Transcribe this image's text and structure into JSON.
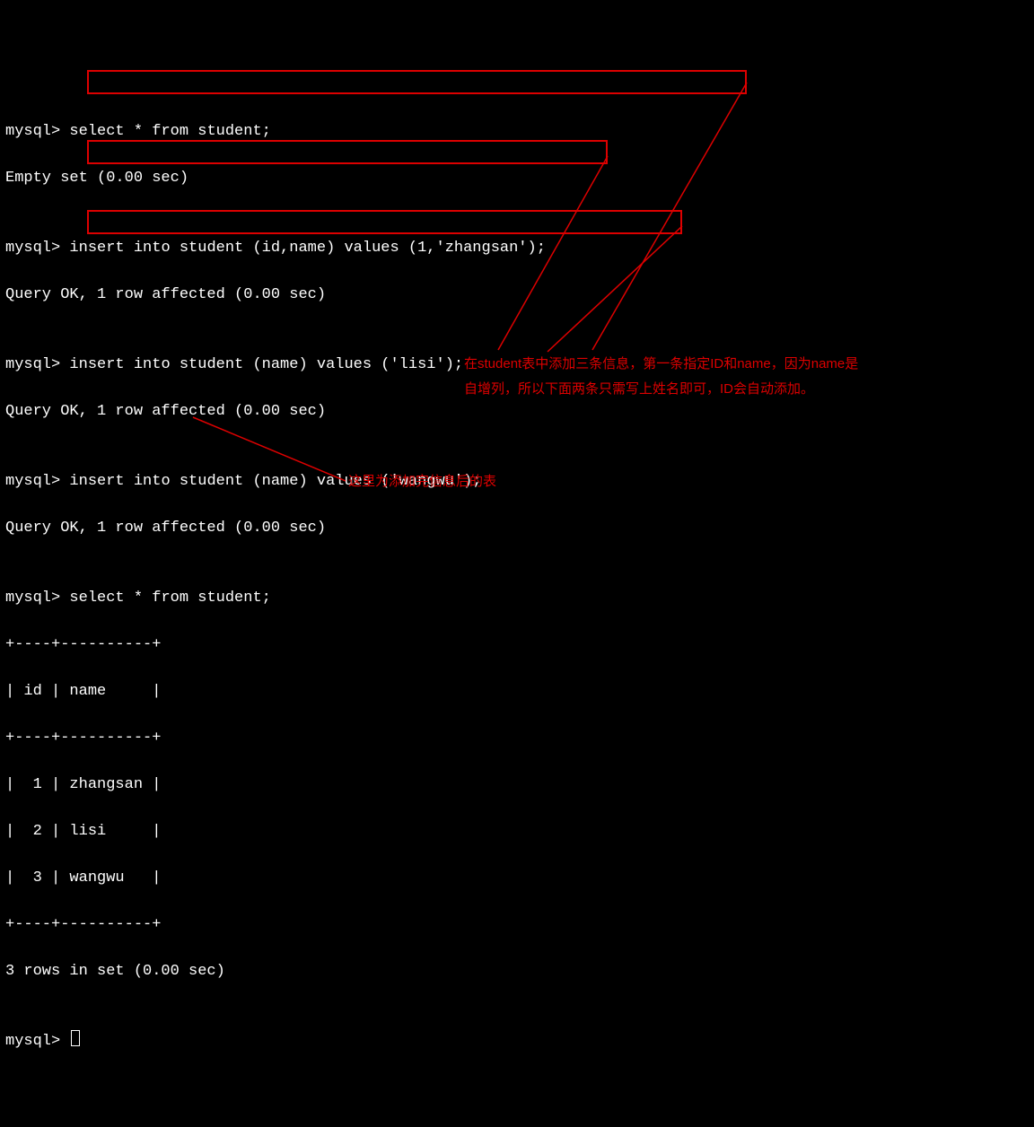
{
  "prompt": "mysql> ",
  "lines": {
    "l1": "select * from student;",
    "l2": "Empty set (0.00 sec)",
    "l3": "",
    "l4": "insert into student (id,name) values (1,'zhangsan');",
    "l5": "Query OK, 1 row affected (0.00 sec)",
    "l6": "",
    "l7": "insert into student (name) values ('lisi');",
    "l8": "Query OK, 1 row affected (0.00 sec)",
    "l9": "",
    "l10": "insert into student (name) values ('wangwu');",
    "l11": "Query OK, 1 row affected (0.00 sec)",
    "l12": "",
    "l13": "select * from student;",
    "l14": "+----+----------+",
    "l15": "| id | name     |",
    "l16": "+----+----------+",
    "l17": "|  1 | zhangsan |",
    "l18": "|  2 | lisi     |",
    "l19": "|  3 | wangwu   |",
    "l20": "+----+----------+",
    "l21": "3 rows in set (0.00 sec)",
    "l22": ""
  },
  "annotations": {
    "a1_l1": "在student表中添加三条信息，第一条指定ID和name，因为name是",
    "a1_l2": "自增列，所以下面两条只需写上姓名即可，ID会自动添加。",
    "a2": "这里为添加完信息后的表"
  },
  "chart_data": {
    "type": "table",
    "title": "student",
    "columns": [
      "id",
      "name"
    ],
    "rows": [
      [
        1,
        "zhangsan"
      ],
      [
        2,
        "lisi"
      ],
      [
        3,
        "wangwu"
      ]
    ],
    "rowcount_text": "3 rows in set (0.00 sec)"
  }
}
